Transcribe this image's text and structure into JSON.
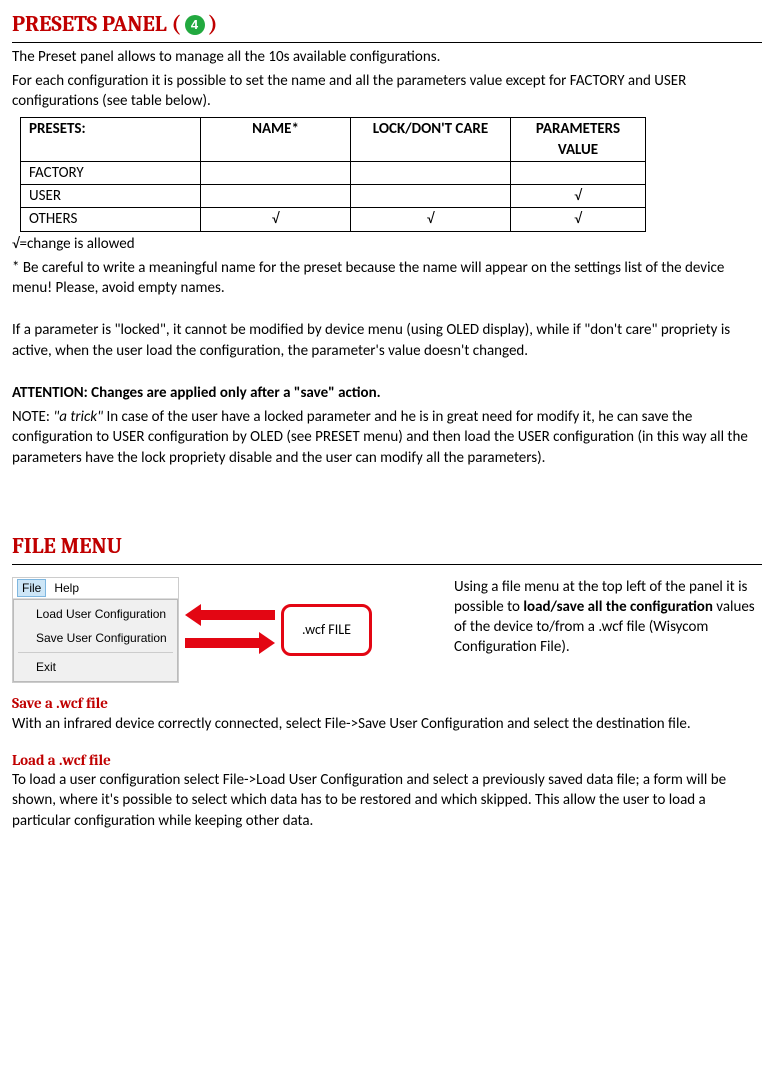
{
  "presets": {
    "heading_prefix": "PRESETS PANEL (",
    "heading_badge": "4",
    "heading_suffix": ")",
    "intro_l1": "The Preset panel allows to manage all the 10s available configurations.",
    "intro_l2": "For each configuration it is possible to set the name and all the parameters value except for FACTORY and USER configurations (see table below).",
    "table": {
      "headers": [
        "PRESETS:",
        "NAME*",
        "LOCK/DON'T CARE",
        "PARAMETERS VALUE"
      ],
      "rows": [
        [
          "FACTORY",
          "",
          "",
          ""
        ],
        [
          "USER",
          "",
          "",
          "√"
        ],
        [
          "OTHERS",
          "√",
          "√",
          "√"
        ]
      ]
    },
    "legend": "√=change is allowed",
    "note_star": "* Be careful to write a meaningful name for the preset because the name will appear on the settings list of the device menu! Please, avoid empty names.",
    "locked_para": "If a parameter is \"locked\", it cannot be modified by device menu (using OLED display), while if \"don't care\" propriety is active, when the user load the configuration, the parameter's value doesn't changed.",
    "attention": "ATTENTION: Changes are applied only after a \"save\" action.",
    "note_label": "NOTE: ",
    "note_trick_em": "\"a trick\"",
    "note_trick_rest": " In case of the user have a locked parameter and he is in great need for modify it, he can save the configuration to USER configuration by OLED (see PRESET menu) and then load the USER configuration (in this way all the parameters have the lock propriety disable and the user can modify all the parameters)."
  },
  "file_menu": {
    "heading": "FILE MENU",
    "menu_bar": {
      "file": "File",
      "help": "Help"
    },
    "dropdown": {
      "load": "Load User Configuration",
      "save": "Save User Configuration",
      "exit": "Exit"
    },
    "wcf_label": ".wcf FILE",
    "side_text_pre": "Using a file menu at the top left of the panel it is possible to ",
    "side_text_bold": "load/save all the configuration",
    "side_text_post": " values of the device to/from a .wcf file (Wisycom Configuration File).",
    "save_heading": "Save a .wcf file",
    "save_body": "With an infrared device correctly connected, select File->Save User Configuration and select the destination file.",
    "load_heading": "Load a .wcf file",
    "load_body": " To load a user configuration select File->Load User Configuration and select a previously saved data file; a form will be shown, where it's possible to select which data has to be restored and which skipped. This allow the user to load a particular configuration while keeping other data."
  }
}
